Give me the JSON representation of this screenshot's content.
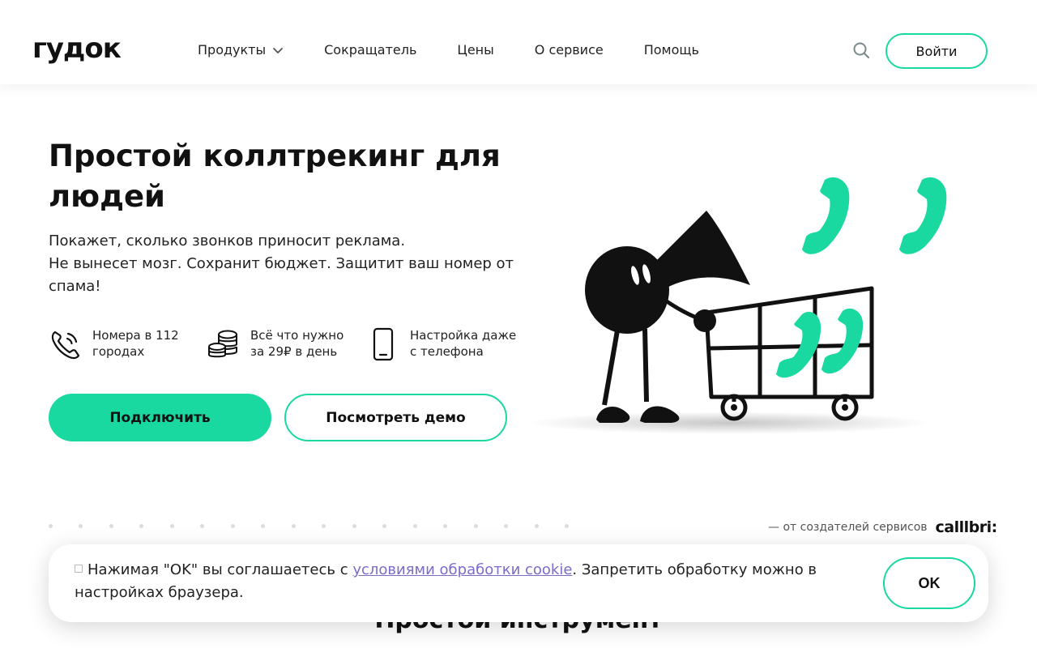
{
  "header": {
    "logo": "гудок",
    "nav": [
      {
        "label": "Продукты",
        "has_dropdown": true
      },
      {
        "label": "Сокращатель"
      },
      {
        "label": "Цены"
      },
      {
        "label": "О сервисе"
      },
      {
        "label": "Помощь"
      }
    ],
    "search_icon": "search-icon",
    "login_label": "Войти"
  },
  "hero": {
    "title": "Простой коллтрекинг для людей",
    "subtitle_lines": [
      "Покажет, сколько звонков приносит реклама.",
      "Не вынесет мозг. Сохранит бюджет. Защитит ваш номер от спама!"
    ],
    "features": [
      {
        "icon": "phone-call-icon",
        "text": "Номера в 112\nгородах"
      },
      {
        "icon": "coins-icon",
        "text": "Всё что нужно\nза 29₽ в день"
      },
      {
        "icon": "smartphone-icon",
        "text": "Настройка даже\nс телефона"
      }
    ],
    "primary_button": "Подключить",
    "secondary_button": "Посмотреть демо"
  },
  "creators": {
    "text": "— от создателей сервисов",
    "brand": "calllbri:"
  },
  "section": {
    "title": "Простой инструмент"
  },
  "cookie": {
    "text_before": "Нажимая \"OK\" вы соглашаетесь с ",
    "link": "условиями обработки cookie",
    "text_after": ". Запретить обработку можно в настройках браузера.",
    "ok_label": "OK"
  },
  "colors": {
    "accent": "#19d9a0",
    "link": "#7a6cc9",
    "text": "#111111"
  }
}
